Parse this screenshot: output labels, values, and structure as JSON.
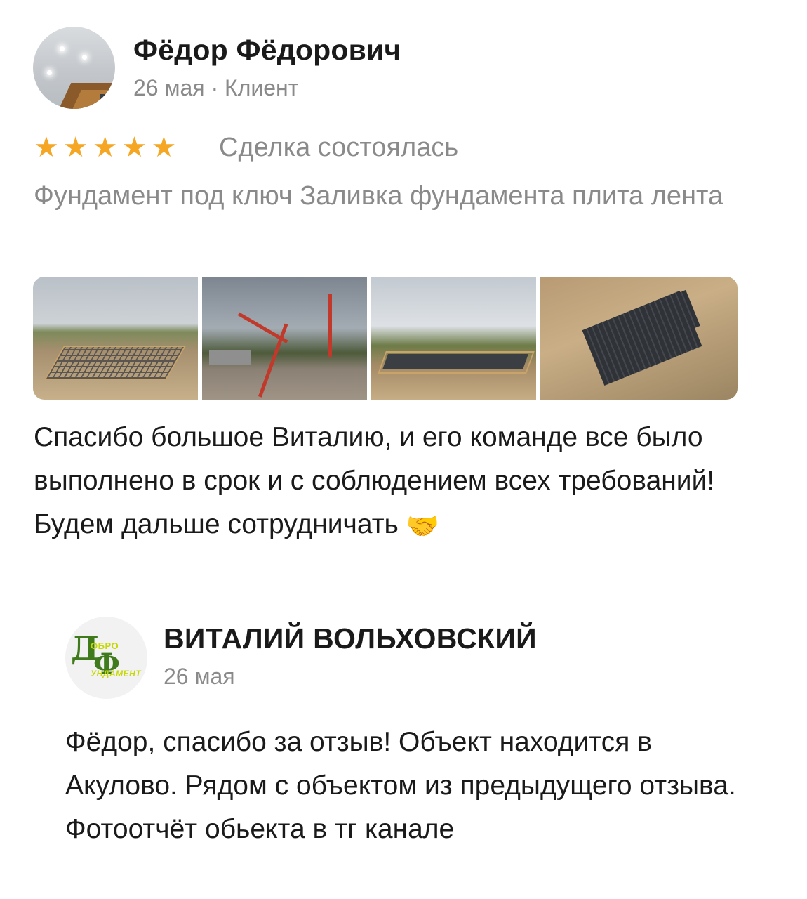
{
  "review": {
    "author_name": "Фёдор Фёдорович",
    "meta": "26 мая · Клиент",
    "rating": 5,
    "star_glyph": "★",
    "deal_status": "Сделка состоялась",
    "service": "Фундамент под ключ Заливка фундамента плита лента",
    "photos_count": 4,
    "text_line1": "Спасибо большое Виталию, и его команде все было выполнено в срок и с соблюдением всех требований!",
    "text_line2": "Будем дальше сотрудничать",
    "emoji": "🤝"
  },
  "reply": {
    "logo_letter1": "Д",
    "logo_word1": "ОБРО",
    "logo_letter2": "Ф",
    "logo_word2": "УНДАМЕНТ",
    "seller_name": "ВИТАЛИЙ ВОЛЬХОВСКИЙ",
    "date": "26 мая",
    "text": "Фёдор, спасибо за отзыв! Объект находится в Акулово. Рядом с объектом из предыдущего отзыва. Фотоотчёт обьекта в тг канале"
  },
  "colors": {
    "star": "#f5a623",
    "muted_text": "#8a8a8a",
    "logo_green": "#3f7a1c",
    "logo_yellow": "#c6d800"
  },
  "icons": [
    "star-icon",
    "handshake-emoji",
    "user-avatar",
    "seller-logo"
  ]
}
